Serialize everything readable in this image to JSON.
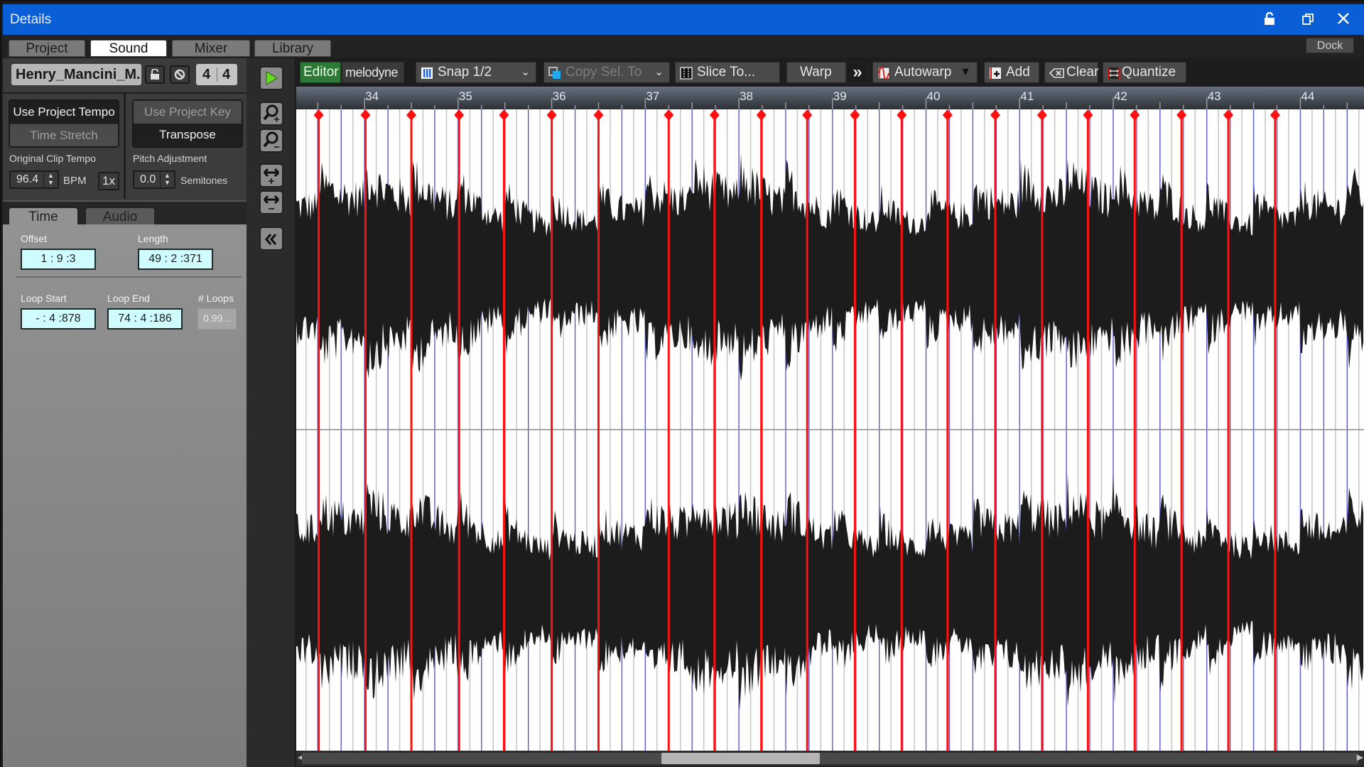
{
  "window": {
    "title": "Details",
    "buttons": {
      "lock": "lock-icon",
      "restore": "restore-icon",
      "close": "close-icon"
    },
    "accent_color": "#0a5fd6"
  },
  "tabs": [
    {
      "label": "Project",
      "active": false
    },
    {
      "label": "Sound",
      "active": true
    },
    {
      "label": "Mixer",
      "active": false
    },
    {
      "label": "Library",
      "active": false
    }
  ],
  "dock_label": "Dock",
  "clip": {
    "name": "Henry_Mancini_M...",
    "time_signature": {
      "numerator": "4",
      "denominator": "4"
    }
  },
  "tempo": {
    "use_project_tempo": "Use Project Tempo",
    "time_stretch": "Time Stretch",
    "original_label": "Original Clip Tempo",
    "value": "96.4",
    "unit": "BPM",
    "multiplier": "1x"
  },
  "pitch": {
    "use_project_key": "Use Project Key",
    "transpose": "Transpose",
    "label": "Pitch Adjustment",
    "value": "0.0",
    "unit": "Semitones"
  },
  "lower_tabs": [
    {
      "label": "Time",
      "active": true
    },
    {
      "label": "Audio",
      "active": false
    }
  ],
  "time_fields": {
    "offset_label": "Offset",
    "offset": "1 : 9 :3",
    "length_label": "Length",
    "length": "49 : 2 :371",
    "loop_start_label": "Loop Start",
    "loop_start": "- : 4 :878",
    "loop_end_label": "Loop End",
    "loop_end": "74 : 4 :186",
    "loops_label": "# Loops",
    "loops": "0.99..."
  },
  "strip_buttons": [
    "play-icon",
    "zoom-in-icon",
    "zoom-out-icon",
    "expand-width-icon",
    "shrink-width-icon",
    "collapse-icon"
  ],
  "toolbar": {
    "editor": "Editor",
    "melodyne": "melodyne",
    "snap": "Snap 1/2",
    "copy_sel": "Copy Sel. To",
    "slice": "Slice To...",
    "warp": "Warp",
    "autowarp": "Autowarp",
    "add": "Add",
    "clear": "Clear",
    "quantize": "Quantize"
  },
  "timeline": {
    "view_start_bar": 33.27,
    "view_end_bar": 44.68,
    "bar_labels": [
      "34",
      "35",
      "36",
      "37",
      "38",
      "39",
      "40",
      "41",
      "42",
      "43",
      "44"
    ],
    "warp_markers_bars": [
      33.51,
      34.01,
      34.5,
      35.01,
      35.49,
      36.0,
      36.5,
      37.25,
      37.74,
      38.24,
      38.73,
      39.24,
      39.74,
      40.23,
      40.74,
      41.24,
      41.73,
      42.23,
      42.73,
      43.23,
      43.73
    ],
    "colors": {
      "warp_marker": "#ff1010",
      "beat_line": "#5a5ad6",
      "sub_line": "#c8c8c8",
      "waveform": "#1c1c1c"
    }
  },
  "scroll": {
    "position": 0.34,
    "visible_fraction": 0.15
  }
}
